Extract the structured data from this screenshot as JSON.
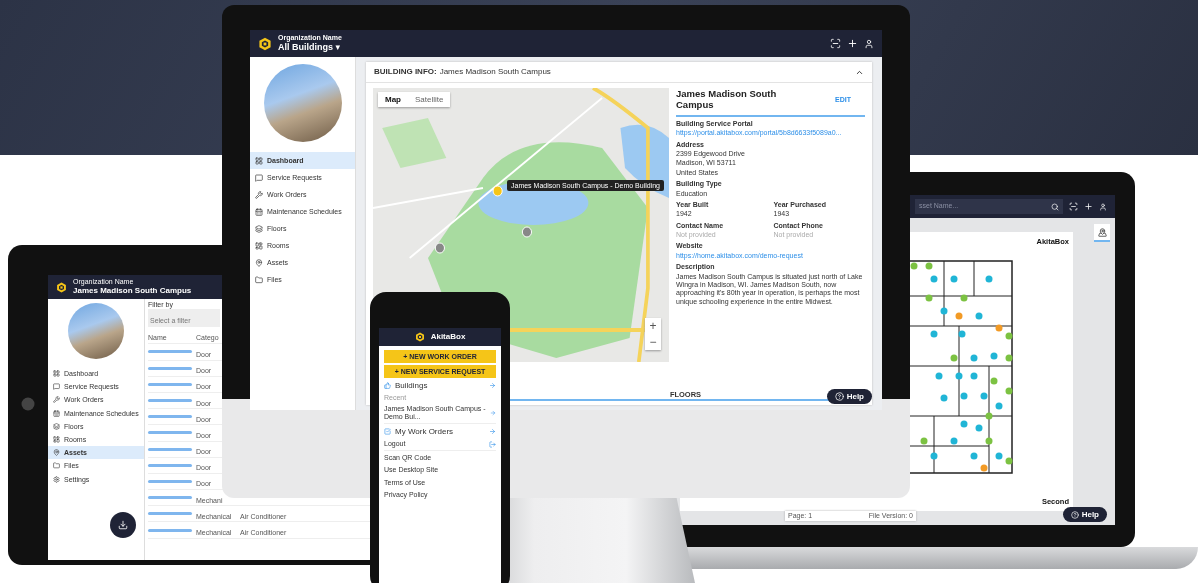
{
  "desktop": {
    "header": {
      "org_label": "Organization Name",
      "building": "All Buildings",
      "caret": "▾"
    },
    "sidebar": [
      {
        "label": "Dashboard",
        "selected": true
      },
      {
        "label": "Service Requests",
        "selected": false
      },
      {
        "label": "Work Orders",
        "selected": false
      },
      {
        "label": "Maintenance Schedules",
        "selected": false
      },
      {
        "label": "Floors",
        "selected": false
      },
      {
        "label": "Rooms",
        "selected": false
      },
      {
        "label": "Assets",
        "selected": false
      },
      {
        "label": "Files",
        "selected": false
      }
    ],
    "card": {
      "heading": "BUILDING INFO:",
      "building_name": "James Madison South Campus",
      "expanded": true
    },
    "map": {
      "tabs": [
        {
          "label": "Map",
          "selected": true
        },
        {
          "label": "Satellite",
          "selected": false
        }
      ],
      "marker_label": "James Madison South Campus - Demo Building",
      "zoom_in": "+",
      "zoom_out": "−"
    },
    "info": {
      "title": "James Madison South Campus",
      "edit": "EDIT",
      "rows": [
        {
          "cells": [
            {
              "label": "Building Service Portal",
              "kind": "link",
              "lines": [
                "https://portal.akitabox.com/portal/5b8d6633f5089a0..."
              ]
            }
          ]
        },
        {
          "cells": [
            {
              "label": "Address",
              "kind": "text",
              "lines": [
                "2399 Edgewood Drive",
                "Madison, WI 53711",
                "United States"
              ]
            }
          ]
        },
        {
          "cells": [
            {
              "label": "Building Type",
              "kind": "text",
              "lines": [
                "Education"
              ]
            }
          ]
        },
        {
          "cells": [
            {
              "label": "Year Built",
              "kind": "text",
              "lines": [
                "1942"
              ]
            },
            {
              "label": "Year Purchased",
              "kind": "text",
              "lines": [
                "1943"
              ]
            }
          ]
        },
        {
          "cells": [
            {
              "label": "Contact Name",
              "kind": "muted",
              "lines": [
                "Not provided"
              ]
            },
            {
              "label": "Contact Phone",
              "kind": "muted",
              "lines": [
                "Not provided"
              ]
            }
          ]
        },
        {
          "cells": [
            {
              "label": "Website",
              "kind": "link",
              "lines": [
                "https://home.akitabox.com/demo-request"
              ]
            }
          ]
        },
        {
          "cells": [
            {
              "label": "Description",
              "kind": "text",
              "lines": [
                "James Madison South Campus is situated just north of Lake Wingra in Madison, WI. James Madison South, now approaching it's 80th year in operation, is perhaps the most unique schooling experience in the entire Midwest."
              ]
            }
          ]
        }
      ]
    },
    "floors_tab": "FLOORS",
    "help": "Help"
  },
  "tablet": {
    "org_label": "Organization Name",
    "building": "James Madison South Campus",
    "sidebar": [
      {
        "label": "Dashboard",
        "selected": false
      },
      {
        "label": "Service Requests",
        "selected": false
      },
      {
        "label": "Work Orders",
        "selected": false
      },
      {
        "label": "Maintenance Schedules",
        "selected": false
      },
      {
        "label": "Floors",
        "selected": false
      },
      {
        "label": "Rooms",
        "selected": false
      },
      {
        "label": "Assets",
        "selected": true
      },
      {
        "label": "Files",
        "selected": false
      },
      {
        "label": "Settings",
        "selected": false
      }
    ],
    "filter_label": "Filter by",
    "filter_placeholder": "Select a filter",
    "columns": [
      "Name",
      "Catego"
    ],
    "rows": [
      {
        "category": "Door"
      },
      {
        "category": "Door"
      },
      {
        "category": "Door"
      },
      {
        "category": "Door"
      },
      {
        "category": "Door"
      },
      {
        "category": "Door"
      },
      {
        "category": "Door"
      },
      {
        "category": "Door"
      },
      {
        "category": "Door"
      },
      {
        "category": "Mechani"
      },
      {
        "category": "Mechanical",
        "type": "Air Conditioner"
      },
      {
        "category": "Mechanical",
        "type": "Air Conditioner"
      }
    ]
  },
  "phone": {
    "brand": "AkitaBox",
    "buttons": [
      "+ NEW WORK ORDER",
      "+ NEW SERVICE REQUEST"
    ],
    "buildings": "Buildings",
    "recent_label": "Recent",
    "recent_building": "James Madison South Campus - Demo Bui...",
    "work_orders": "My Work Orders",
    "logout": "Logout",
    "links": [
      "Scan QR Code",
      "Use Desktop Site",
      "Terms of Use",
      "Privacy Policy"
    ]
  },
  "laptop": {
    "search_placeholder": "sset Name...",
    "sheet_brand": "AkitaBox",
    "floor_name": "Second",
    "page": "Page: 1",
    "file_version": "File Version: 0",
    "help": "Help"
  }
}
